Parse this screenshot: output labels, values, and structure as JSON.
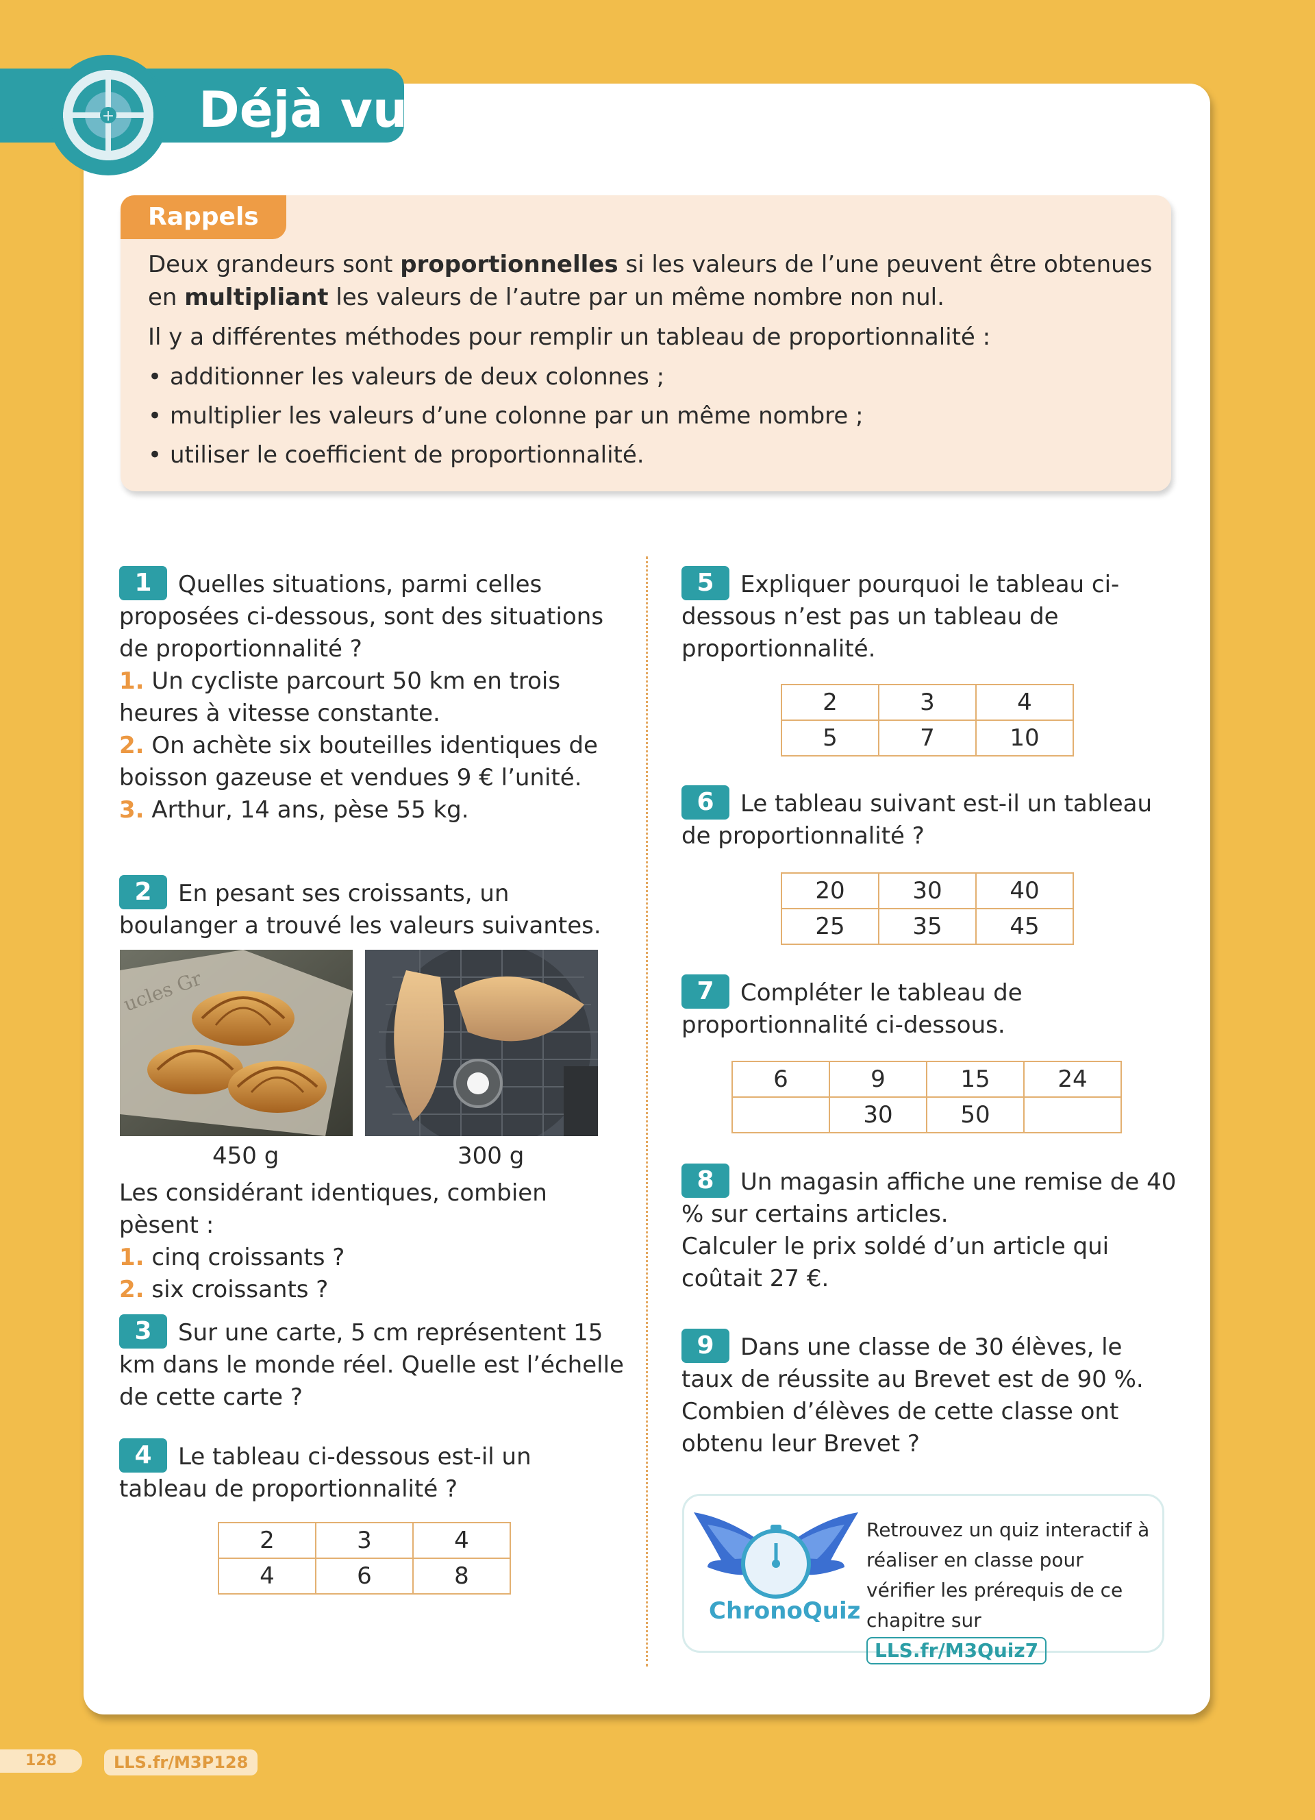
{
  "header": {
    "title": "Déjà vu"
  },
  "rappels": {
    "tab": "Rappels",
    "p1_a": "Deux grandeurs sont ",
    "p1_b": "proportionnelles",
    "p1_c": " si les valeurs de l’une peuvent être obtenues en ",
    "p1_d": "multipliant",
    "p1_e": " les valeurs de l’autre par un même nombre non nul.",
    "p2": "Il y a différentes méthodes pour remplir un tableau de proportionnalité :",
    "bullets": [
      "additionner les valeurs de deux colonnes ;",
      "multiplier les valeurs d’une colonne par un même nombre ;",
      "utiliser le coefficient de proportionnalité."
    ]
  },
  "ex1": {
    "num": "1",
    "q": "Quelles situations, parmi celles proposées ci-dessous, sont des situations de proportionnalité ?",
    "items": [
      {
        "n": "1.",
        "t": " Un cycliste parcourt 50 km en trois heures à vitesse constante."
      },
      {
        "n": "2.",
        "t": " On achète six bouteilles identiques de boisson gazeuse et vendues 9 € l’unité."
      },
      {
        "n": "3.",
        "t": " Arthur, 14 ans, pèse 55 kg."
      }
    ]
  },
  "ex2": {
    "num": "2",
    "q": "En pesant ses croissants, un boulanger a trouvé les valeurs suivantes.",
    "cap1": "450 g",
    "cap2": "300 g",
    "q2": "Les considérant identiques, combien pèsent :",
    "items": [
      {
        "n": "1.",
        "t": " cinq croissants ?"
      },
      {
        "n": "2.",
        "t": " six croissants ?"
      }
    ]
  },
  "ex3": {
    "num": "3",
    "q": "Sur une carte, 5 cm représentent 15 km dans le monde réel. Quelle est l’échelle de cette carte ?"
  },
  "ex4": {
    "num": "4",
    "q": "Le tableau ci-dessous est-il un tableau de proportionnalité ?",
    "table": [
      [
        "2",
        "3",
        "4"
      ],
      [
        "4",
        "6",
        "8"
      ]
    ]
  },
  "ex5": {
    "num": "5",
    "q": "Expliquer pourquoi le tableau ci-dessous n’est pas un tableau de proportionnalité.",
    "table": [
      [
        "2",
        "3",
        "4"
      ],
      [
        "5",
        "7",
        "10"
      ]
    ]
  },
  "ex6": {
    "num": "6",
    "q": "Le tableau suivant est-il un tableau de proportionnalité ?",
    "table": [
      [
        "20",
        "30",
        "40"
      ],
      [
        "25",
        "35",
        "45"
      ]
    ]
  },
  "ex7": {
    "num": "7",
    "q": "Compléter le tableau de proportionnalité ci-dessous.",
    "table": [
      [
        "6",
        "9",
        "15",
        "24"
      ],
      [
        "",
        "30",
        "50",
        ""
      ]
    ]
  },
  "ex8": {
    "num": "8",
    "q": "Un magasin affiche une remise de 40 % sur certains articles.",
    "q2": "Calculer le prix soldé d’un article qui coûtait 27 €."
  },
  "ex9": {
    "num": "9",
    "q": "Dans une classe de 30 élèves, le taux de réussite au Brevet est de 90 %.",
    "q2": "Combien d’élèves de cette classe ont obtenu leur Brevet ?"
  },
  "quiz": {
    "logo": "ChronoQuiz",
    "text": "Retrouvez un quiz interactif à réaliser en classe pour vérifier les prérequis de ce chapitre sur",
    "link": "LLS.fr/M3Quiz7"
  },
  "footer": {
    "page": "128",
    "link": "LLS.fr/M3P128"
  },
  "colors": {
    "teal": "#2c9ea6",
    "orange": "#ee9c45",
    "background": "#f2bd4b",
    "cream": "#fbeadb"
  }
}
